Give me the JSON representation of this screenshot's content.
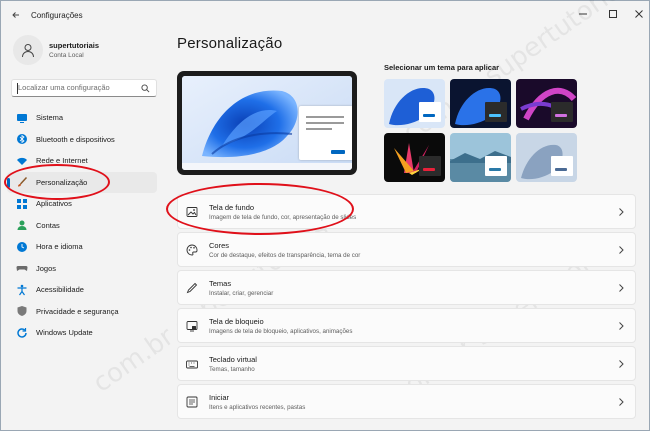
{
  "window": {
    "app_title": "Configurações",
    "icons": {
      "back": "back-arrow-icon",
      "minimize": "minimize-icon",
      "maximize": "maximize-icon",
      "close": "close-icon"
    }
  },
  "profile": {
    "name": "supertutoriais",
    "subtitle": "Conta Local",
    "avatar_icon": "person-icon"
  },
  "search": {
    "placeholder": "Localizar uma configuração",
    "icon": "search-icon"
  },
  "sidebar": {
    "items": [
      {
        "label": "Sistema",
        "icon": "monitor-icon",
        "color": "#0078d4"
      },
      {
        "label": "Bluetooth e dispositivos",
        "icon": "bluetooth-icon",
        "color": "#0078d4"
      },
      {
        "label": "Rede e Internet",
        "icon": "wifi-icon",
        "color": "#0078d4"
      },
      {
        "label": "Personalização",
        "icon": "brush-icon",
        "color": "#c4541e",
        "active": true
      },
      {
        "label": "Aplicativos",
        "icon": "apps-icon",
        "color": "#0078d4"
      },
      {
        "label": "Contas",
        "icon": "account-icon",
        "color": "#2aa05a"
      },
      {
        "label": "Hora e idioma",
        "icon": "globe-clock-icon",
        "color": "#0078d4"
      },
      {
        "label": "Jogos",
        "icon": "gamepad-icon",
        "color": "#5d5d5d"
      },
      {
        "label": "Acessibilidade",
        "icon": "accessibility-icon",
        "color": "#0078d4"
      },
      {
        "label": "Privacidade e segurança",
        "icon": "shield-icon",
        "color": "#5d5d5d"
      },
      {
        "label": "Windows Update",
        "icon": "update-icon",
        "color": "#0078d4"
      }
    ]
  },
  "main": {
    "title": "Personalização",
    "themes_label": "Selecionar um tema para aplicar",
    "cards": [
      {
        "title": "Tela de fundo",
        "desc": "Imagem de tela de fundo, cor, apresentação de slides",
        "icon": "image-icon"
      },
      {
        "title": "Cores",
        "desc": "Cor de destaque, efeitos de transparência, tema de cor",
        "icon": "palette-icon"
      },
      {
        "title": "Temas",
        "desc": "Instalar, criar, gerenciar",
        "icon": "pen-icon"
      },
      {
        "title": "Tela de bloqueio",
        "desc": "Imagens de tela de bloqueio, aplicativos, animações",
        "icon": "lock-screen-icon"
      },
      {
        "title": "Teclado virtual",
        "desc": "Temas, tamanho",
        "icon": "keyboard-icon"
      },
      {
        "title": "Iniciar",
        "desc": "Itens e aplicativos recentes, pastas",
        "icon": "start-menu-icon"
      }
    ]
  },
  "colors": {
    "accent": "#0067c0",
    "annotation": "#e0101a"
  },
  "watermark": "com.br supertutoriais"
}
